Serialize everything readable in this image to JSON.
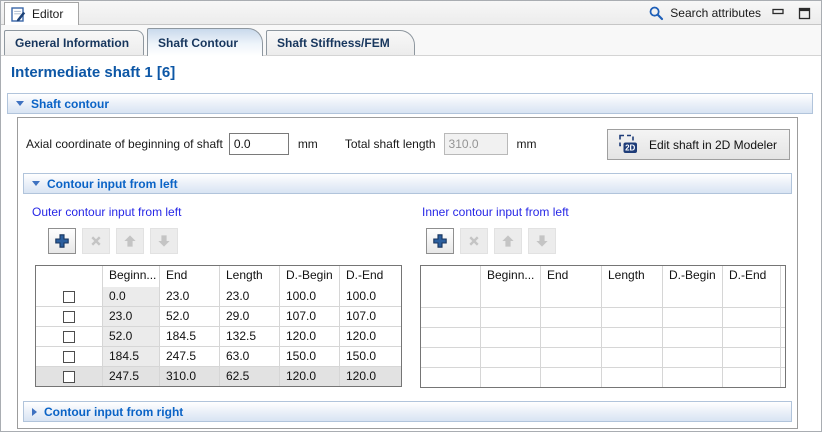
{
  "window": {
    "editor_tab_label": "Editor",
    "search_label": "Search attributes"
  },
  "tabs": [
    {
      "label": "General Information",
      "active": false
    },
    {
      "label": "Shaft Contour",
      "active": true
    },
    {
      "label": "Shaft Stiffness/FEM",
      "active": false
    }
  ],
  "page_title": "Intermediate shaft 1 [6]",
  "shaft_contour": {
    "header": "Shaft contour",
    "axial_label": "Axial coordinate of beginning of shaft",
    "axial_value": "0.0",
    "axial_unit": "mm",
    "total_label": "Total shaft length",
    "total_value": "310.0",
    "total_unit": "mm",
    "edit_button_label": "Edit shaft in 2D Modeler",
    "edit_button_icon_text": "2D"
  },
  "toolbar_buttons": [
    {
      "name": "add",
      "icon": "plus-icon",
      "enabled": true
    },
    {
      "name": "delete",
      "icon": "x-icon",
      "enabled": false
    },
    {
      "name": "move-up",
      "icon": "arrow-up-icon",
      "enabled": false
    },
    {
      "name": "move-down",
      "icon": "arrow-down-icon",
      "enabled": false
    }
  ],
  "contour_left": {
    "header": "Contour input from left",
    "outer": {
      "title": "Outer contour input from left",
      "columns": [
        "",
        "Beginn...",
        "End",
        "Length",
        "D.-Begin",
        "D.-End"
      ],
      "rows": [
        [
          "0.0",
          "23.0",
          "23.0",
          "100.0",
          "100.0"
        ],
        [
          "23.0",
          "52.0",
          "29.0",
          "107.0",
          "107.0"
        ],
        [
          "52.0",
          "184.5",
          "132.5",
          "120.0",
          "120.0"
        ],
        [
          "184.5",
          "247.5",
          "63.0",
          "150.0",
          "150.0"
        ],
        [
          "247.5",
          "310.0",
          "62.5",
          "120.0",
          "120.0"
        ]
      ],
      "selected_row": 4,
      "visible_empty_rows": 0,
      "trailing_filler": false
    },
    "inner": {
      "title": "Inner contour input from left",
      "columns": [
        "",
        "Beginn...",
        "End",
        "Length",
        "D.-Begin",
        "D.-End"
      ],
      "rows": [],
      "selected_row": -1,
      "visible_empty_rows": 5,
      "trailing_filler": true
    }
  },
  "contour_right": {
    "header": "Contour input from right"
  },
  "colors": {
    "section_header_blue": "#0a63c6",
    "sub_label_blue": "#2727e6",
    "title_blue": "#0d57a6",
    "selected_row_gray": "#e2e2e2",
    "column_highlight_gray": "#ebebeb",
    "icon_blue": "#2c5f9e"
  }
}
